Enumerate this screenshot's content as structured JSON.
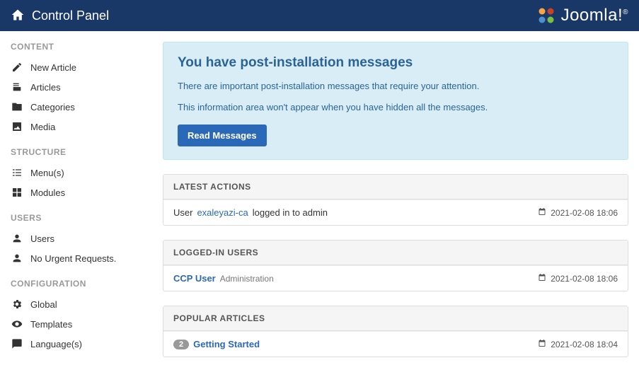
{
  "header": {
    "title": "Control Panel",
    "brand": "Joomla!",
    "brand_reg": "®"
  },
  "sidebar": {
    "sections": {
      "content": {
        "header": "CONTENT",
        "items": [
          "New Article",
          "Articles",
          "Categories",
          "Media"
        ]
      },
      "structure": {
        "header": "STRUCTURE",
        "items": [
          "Menu(s)",
          "Modules"
        ]
      },
      "users": {
        "header": "USERS",
        "items": [
          "Users",
          "No Urgent Requests."
        ]
      },
      "configuration": {
        "header": "CONFIGURATION",
        "items": [
          "Global",
          "Templates",
          "Language(s)"
        ]
      }
    }
  },
  "alert": {
    "title": "You have post-installation messages",
    "line1": "There are important post-installation messages that require your attention.",
    "line2": "This information area won't appear when you have hidden all the messages.",
    "button": "Read Messages"
  },
  "panels": {
    "latest_actions": {
      "title": "LATEST ACTIONS",
      "row_prefix": "User ",
      "row_user": "exaleyazi-ca",
      "row_suffix": " logged in to admin",
      "timestamp": "2021-02-08 18:06"
    },
    "logged_in": {
      "title": "LOGGED-IN USERS",
      "user": "CCP User",
      "area": "Administration",
      "timestamp": "2021-02-08 18:06"
    },
    "popular": {
      "title": "POPULAR ARTICLES",
      "badge": "2",
      "article": "Getting Started",
      "timestamp": "2021-02-08 18:04"
    }
  }
}
